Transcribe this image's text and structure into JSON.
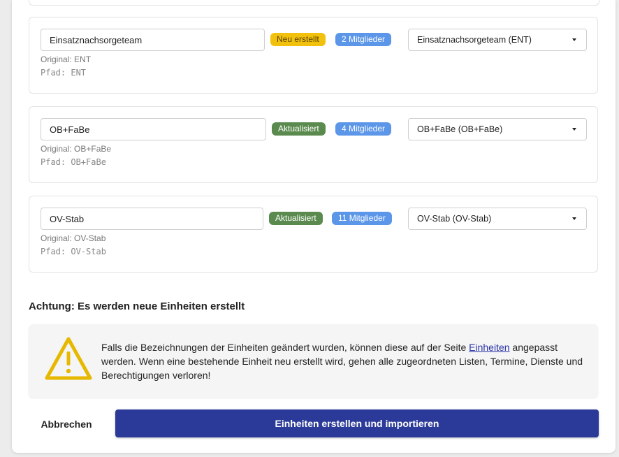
{
  "units": [
    {
      "name_value": "Einsatznachsorgeteam",
      "status": "Neu erstellt",
      "members": "2 Mitglieder",
      "mapping": "Einsatznachsorgeteam (ENT)",
      "original": "Original: ENT",
      "path": "Pfad: ENT"
    },
    {
      "name_value": "OB+FaBe",
      "status": "Aktualisiert",
      "members": "4 Mitglieder",
      "mapping": "OB+FaBe (OB+FaBe)",
      "original": "Original: OB+FaBe",
      "path": "Pfad: OB+FaBe"
    },
    {
      "name_value": "OV-Stab",
      "status": "Aktualisiert",
      "members": "11 Mitglieder",
      "mapping": "OV-Stab (OV-Stab)",
      "original": "Original: OV-Stab",
      "path": "Pfad: OV-Stab"
    }
  ],
  "warning": {
    "title": "Achtung: Es werden neue Einheiten erstellt",
    "text_before_link": "Falls die Bezeichnungen der Einheiten geändert wurden, können diese auf der Seite ",
    "link": "Einheiten",
    "text_after_link": " angepasst werden. Wenn eine bestehende Einheit neu erstellt wird, gehen alle zugeordneten Listen, Termine, Dienste und Berechtigungen verloren!",
    "icon": "warning-triangle-icon",
    "icon_color": "#e6b800"
  },
  "actions": {
    "cancel": "Abbrechen",
    "submit": "Einheiten erstellen und importieren"
  },
  "colors": {
    "status_new": "#f2c10d",
    "status_updated": "#5b8a4f",
    "members_badge": "#5b96e8",
    "primary_button": "#2b3a98",
    "link": "#2933a6"
  }
}
